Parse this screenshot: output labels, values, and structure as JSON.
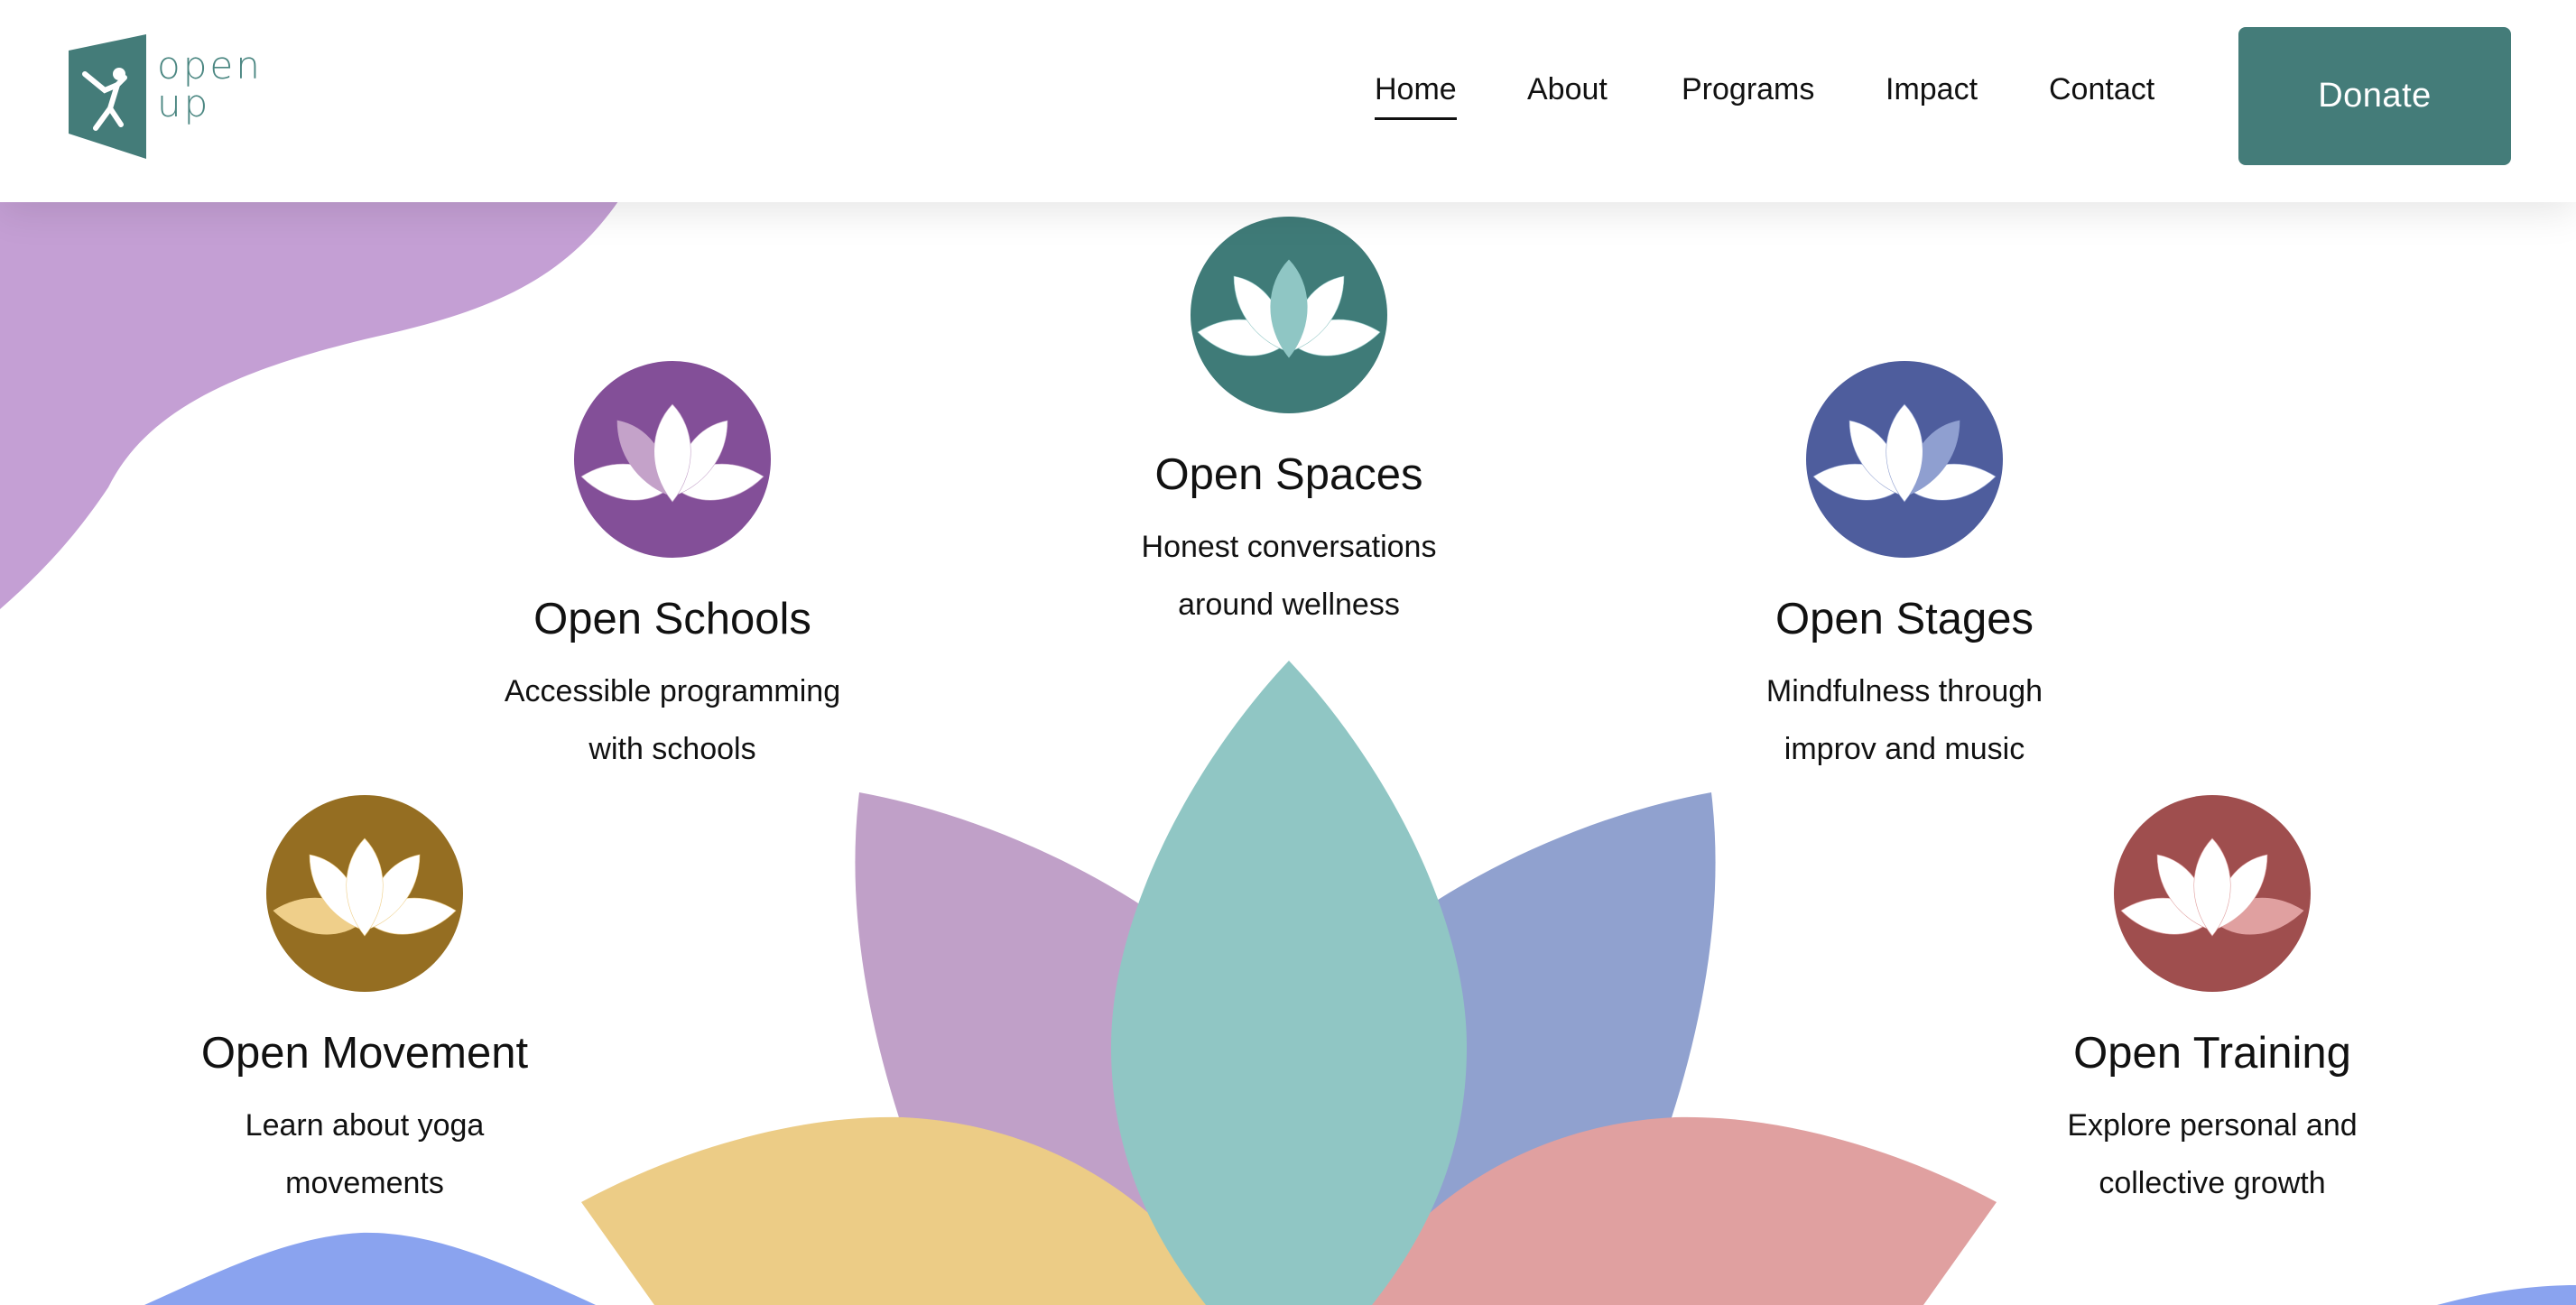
{
  "logo": {
    "line1": "open",
    "line2": "up"
  },
  "nav": {
    "items": [
      "Home",
      "About",
      "Programs",
      "Impact",
      "Contact"
    ],
    "active": "Home",
    "donate_label": "Donate"
  },
  "programs": [
    {
      "title": "Open Spaces",
      "desc_line1": "Honest conversations",
      "desc_line2": "around wellness",
      "color": "#3f7b78",
      "accent": "#8fc6c4"
    },
    {
      "title": "Open Schools",
      "desc_line1": "Accessible programming",
      "desc_line2": "with schools",
      "color": "#834f98",
      "accent": "#c4a2c9"
    },
    {
      "title": "Open Stages",
      "desc_line1": "Mindfulness through",
      "desc_line2": "improv and music",
      "color": "#4e5d9d",
      "accent": "#8f9fd0"
    },
    {
      "title": "Open Movement",
      "desc_line1": "Learn about yoga",
      "desc_line2": "movements",
      "color": "#956e22",
      "accent": "#efcf8a"
    },
    {
      "title": "Open Training",
      "desc_line1": "Explore personal and",
      "desc_line2": "collective growth",
      "color": "#9f4e4e",
      "accent": "#e0a0a0"
    }
  ],
  "colors": {
    "brand": "#447c79",
    "blob_purple": "#c49fd4",
    "petal_teal": "#90c6c4",
    "petal_purple": "#c0a0c8",
    "petal_blue": "#90a1cf",
    "petal_yellow": "#eccc86",
    "petal_pink": "#e0a0a0",
    "wave_blue": "#8aa3ef"
  }
}
